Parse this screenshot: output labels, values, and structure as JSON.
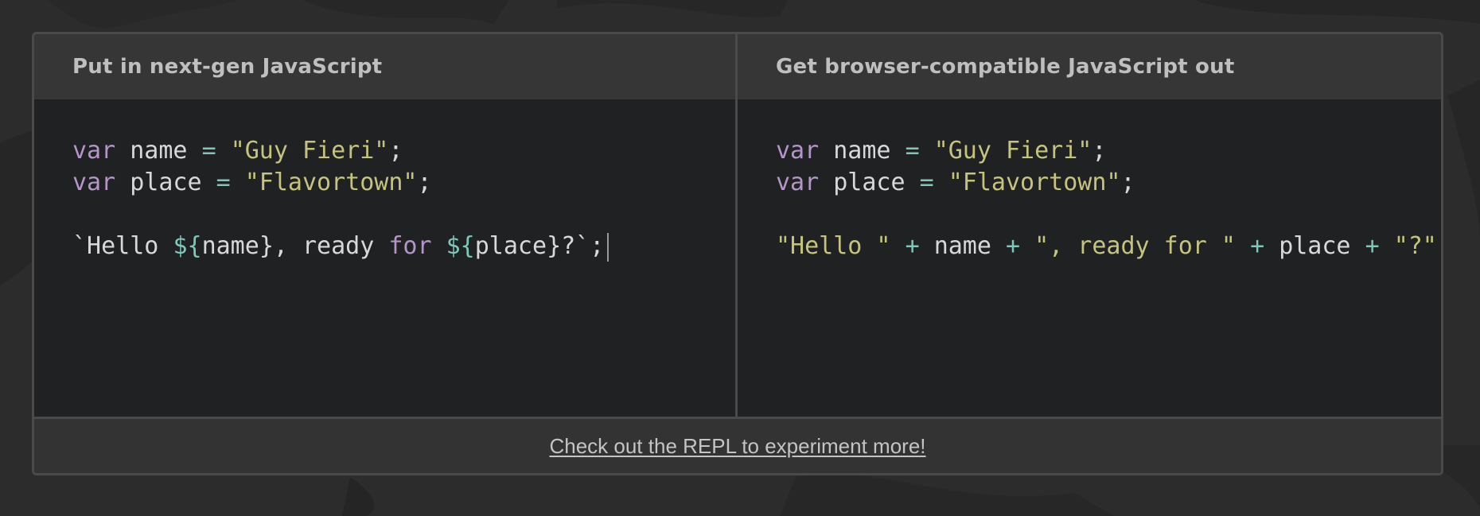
{
  "left_pane": {
    "title": "Put in next-gen JavaScript",
    "code": {
      "line1": {
        "kw": "var",
        "id": "name",
        "op": "=",
        "str": "\"Guy Fieri\"",
        "punc": ";"
      },
      "line2": {
        "kw": "var",
        "id": "place",
        "op": "=",
        "str": "\"Flavortown\"",
        "punc": ";"
      },
      "line3": {
        "tick_open": "`Hello ",
        "interp1_open": "${",
        "interp1_name": "name",
        "interp1_close": "}, ready ",
        "kw_for": "for",
        "space": " ",
        "interp2_open": "${",
        "interp2_name": "place",
        "interp2_close": "}?`;"
      }
    }
  },
  "right_pane": {
    "title": "Get browser-compatible JavaScript out",
    "code": {
      "line1": {
        "kw": "var",
        "id": "name",
        "op": "=",
        "str": "\"Guy Fieri\"",
        "punc": ";"
      },
      "line2": {
        "kw": "var",
        "id": "place",
        "op": "=",
        "str": "\"Flavortown\"",
        "punc": ";"
      },
      "line3": {
        "str1": "\"Hello \"",
        "op1": "+",
        "id1": "name",
        "op2": "+",
        "str2": "\", ready for \"",
        "op3": "+",
        "id2": "place",
        "op4": "+",
        "str3": "\"?\""
      }
    }
  },
  "footer": {
    "link_text": "Check out the REPL to experiment more!"
  },
  "colors": {
    "keyword": "#b395c7",
    "operator": "#7fc6bb",
    "string": "#c5c37e",
    "text": "#d8d8d8",
    "background": "#2c2c2c",
    "editor_bg": "#202123",
    "header_bg": "#363636"
  }
}
